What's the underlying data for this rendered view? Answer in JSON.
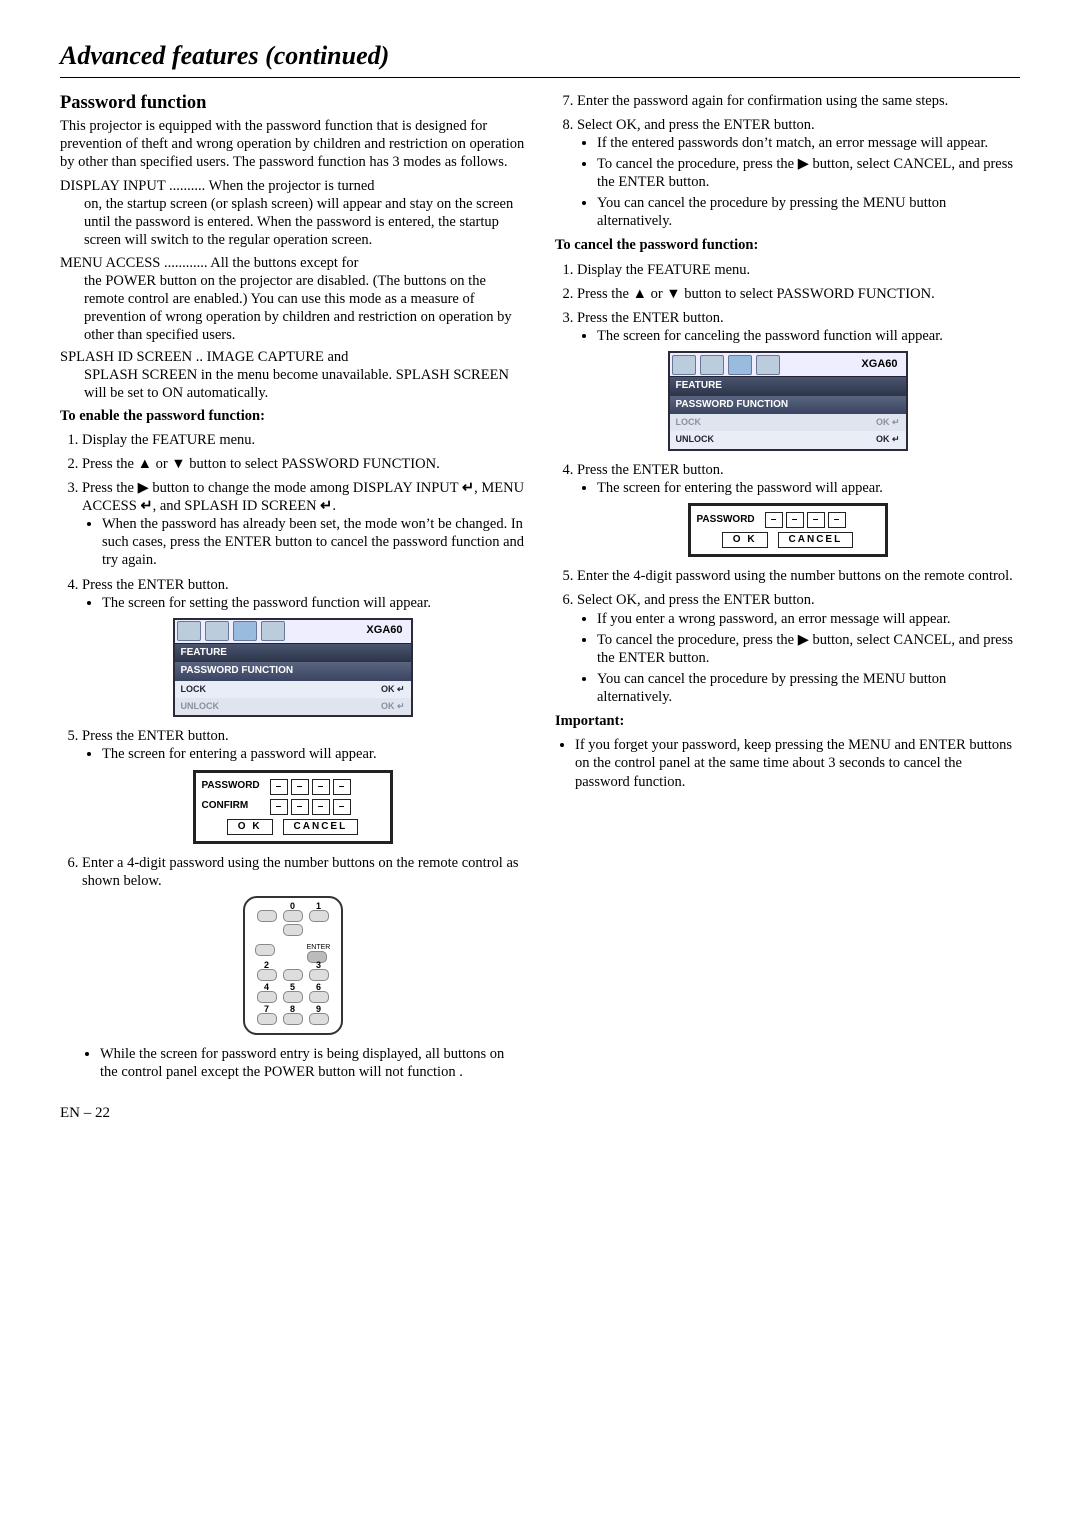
{
  "page": {
    "title": "Advanced features (continued)",
    "footer": "EN – 22"
  },
  "left": {
    "heading": "Password function",
    "intro": "This projector is equipped with the password function that is designed for prevention of theft and wrong operation by children and restriction on operation by other than specified users. The password function has 3 modes as follows.",
    "defs": {
      "d1name": "DISPLAY INPUT",
      "d1dots": " .......... ",
      "d1text": "When the projector is turned on, the startup screen (or splash screen) will appear and stay on the screen until the password is entered. When the password is entered, the startup screen will switch to the regular operation screen.",
      "d2name": "MENU ACCESS",
      "d2dots": " ............ ",
      "d2text": "All the buttons except for the POWER button on the projector are disabled. (The buttons on the remote control are enabled.) You can use this mode as a measure of prevention of wrong operation by children and restriction on operation by other than specified users.",
      "d3name": "SPLASH ID SCREEN",
      "d3dots": "  .. ",
      "d3text": "IMAGE CAPTURE and SPLASH SCREEN in the menu become unavailable. SPLASH SCREEN will be set to ON automatically."
    },
    "enableHeading": "To enable the password function:",
    "s1": "Display the FEATURE menu.",
    "s2a": "Press the ",
    "s2b": " or ",
    "s2c": " button to select PASSWORD FUNCTION.",
    "s3a": "Press the ",
    "s3b": " button to change the mode among DISPLAY INPUT ",
    "s3c": ", MENU ACCESS ",
    "s3d": ", and SPLASH ID SCREEN ",
    "s3e": ".",
    "s3bullet": "When the password has already been set, the mode won’t be changed. In such cases, press the ENTER button to cancel the password function and try again.",
    "s4": "Press the ENTER button.",
    "s4bullet": "The screen for setting the password function will appear.",
    "osd1": {
      "res": "XGA60",
      "feature": "FEATURE",
      "pwfunc": "PASSWORD FUNCTION",
      "lock": "LOCK",
      "unlock": "UNLOCK",
      "ok": "OK"
    },
    "s5": "Press the ENTER button.",
    "s5bullet": "The screen for entering a password will appear.",
    "pw1": {
      "password": "PASSWORD",
      "confirm": "CONFIRM",
      "dash": "–",
      "ok": "O K",
      "cancel": "CANCEL"
    },
    "s6": "Enter a 4-digit password using the number buttons on the remote control as shown below.",
    "remote": {
      "n0": "0",
      "n1": "1",
      "n2": "2",
      "n3": "3",
      "n4": "4",
      "n5": "5",
      "n6": "6",
      "n7": "7",
      "n8": "8",
      "n9": "9",
      "enter": "ENTER"
    },
    "s6bullet": "While the screen for password entry is being displayed, all buttons on the control panel except the POWER button will not function ."
  },
  "right": {
    "s7": "Enter the password again for confirmation using the same steps.",
    "s8": "Select OK, and press the ENTER button.",
    "s8b1": "If the entered passwords don’t match, an error message will appear.",
    "s8b2a": "To cancel the procedure, press the ",
    "s8b2b": " button, select CANCEL, and press the ENTER button.",
    "s8b3": "You can cancel the procedure by pressing the MENU button alternatively.",
    "cancelHeading": "To cancel the password function:",
    "c1": "Display the FEATURE menu.",
    "c2a": "Press the ",
    "c2b": " or ",
    "c2c": " button to select PASSWORD FUNCTION.",
    "c3": "Press the ENTER button.",
    "c3bullet": "The screen for canceling the password function will appear.",
    "osd2": {
      "res": "XGA60",
      "feature": "FEATURE",
      "pwfunc": "PASSWORD FUNCTION",
      "lock": "LOCK",
      "unlock": "UNLOCK",
      "ok": "OK"
    },
    "c4": "Press the ENTER button.",
    "c4bullet": "The screen for entering the password will appear.",
    "pw2": {
      "password": "PASSWORD",
      "dash": "–",
      "ok": "O K",
      "cancel": "CANCEL"
    },
    "c5": "Enter the 4-digit password using the number buttons on the remote control.",
    "c6": "Select OK, and press the ENTER button.",
    "c6b1": "If you enter a wrong password, an error message will appear.",
    "c6b2a": "To cancel the procedure, press the ",
    "c6b2b": " button, select CANCEL, and press the ENTER button.",
    "c6b3": "You can cancel the procedure by pressing the MENU button alternatively.",
    "importantHeading": "Important:",
    "importantText": "If you forget your password, keep pressing the MENU and ENTER buttons on the control panel at the same time about 3 seconds to cancel the password function."
  }
}
